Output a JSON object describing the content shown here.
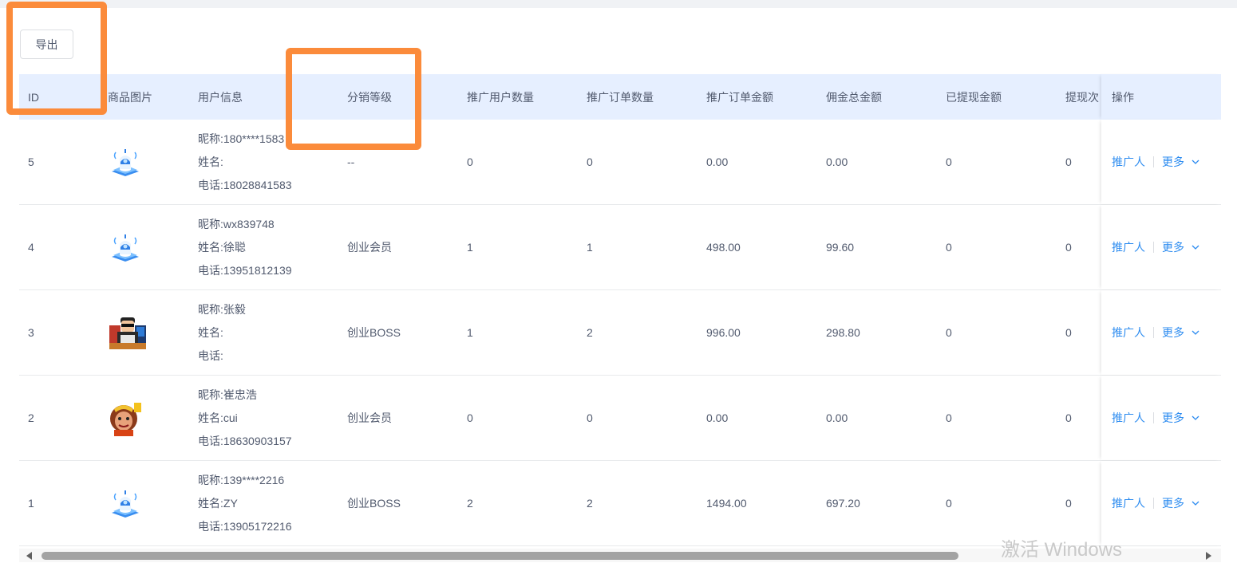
{
  "toolbar": {
    "export_label": "导出"
  },
  "table": {
    "columns": [
      "ID",
      "商品图片",
      "用户信息",
      "分销等级",
      "推广用户数量",
      "推广订单数量",
      "推广订单金额",
      "佣金总金额",
      "已提现金额",
      "提现次"
    ],
    "action_column": "操作",
    "actions": {
      "promoter": "推广人",
      "more": "更多"
    },
    "rows": [
      {
        "id": "5",
        "image": "robot-avatar-icon",
        "nickname": "昵称:180****1583",
        "name": "姓名:",
        "phone": "电话:18028841583",
        "level": "--",
        "promo_users": "0",
        "promo_orders": "0",
        "promo_amount": "0.00",
        "commission_total": "0.00",
        "withdrawn": "0",
        "withdraw_count": "0"
      },
      {
        "id": "4",
        "image": "robot-avatar-icon",
        "nickname": "昵称:wx839748",
        "name": "姓名:徐聪",
        "phone": "电话:13951812139",
        "level": "创业会员",
        "promo_users": "1",
        "promo_orders": "1",
        "promo_amount": "498.00",
        "commission_total": "99.60",
        "withdrawn": "0",
        "withdraw_count": "0"
      },
      {
        "id": "3",
        "image": "man-sunglasses-avatar-icon",
        "nickname": "昵称:张毅",
        "name": "姓名:",
        "phone": "电话:",
        "level": "创业BOSS",
        "promo_users": "1",
        "promo_orders": "2",
        "promo_amount": "996.00",
        "commission_total": "298.80",
        "withdrawn": "0",
        "withdraw_count": "0"
      },
      {
        "id": "2",
        "image": "monkey-king-avatar-icon",
        "nickname": "昵称:崔忠浩",
        "name": "姓名:cui",
        "phone": "电话:18630903157",
        "level": "创业会员",
        "promo_users": "0",
        "promo_orders": "0",
        "promo_amount": "0.00",
        "commission_total": "0.00",
        "withdrawn": "0",
        "withdraw_count": "0"
      },
      {
        "id": "1",
        "image": "robot-avatar-icon",
        "nickname": "昵称:139****2216",
        "name": "姓名:ZY",
        "phone": "电话:13905172216",
        "level": "创业BOSS",
        "promo_users": "2",
        "promo_orders": "2",
        "promo_amount": "1494.00",
        "commission_total": "697.20",
        "withdrawn": "0",
        "withdraw_count": "0"
      }
    ]
  },
  "watermark": "激活 Windows",
  "colors": {
    "accent": "#2d8cf0",
    "header_bg": "#e6efff",
    "annotation": "#fb8b3b",
    "text": "#515a6e"
  }
}
